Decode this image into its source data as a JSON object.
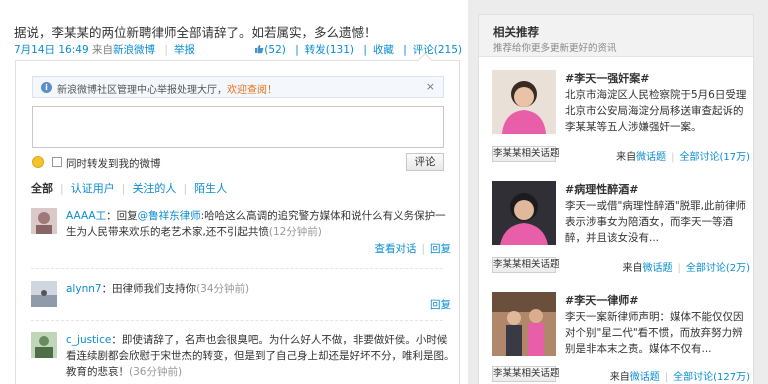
{
  "post": {
    "text": "据说，李某某的两位新聘律师全部请辞了。如若属实，多么遗憾！",
    "date": "7月14日 16:49",
    "source_prefix": "来自",
    "source": "新浪微博",
    "report": "举报",
    "likes": "(52)",
    "repost": "转发(131)",
    "favorite": "收藏",
    "comment": "评论(215)"
  },
  "composer": {
    "notice_text": "新浪微博社区管理中心举报处理大厅，",
    "notice_link": "欢迎查阅！",
    "notice_close": "×",
    "also_repost_label": "同时转发到我的微博",
    "submit_label": "评论"
  },
  "filters": {
    "all": "全部",
    "verified": "认证用户",
    "following": "关注的人",
    "strangers": "陌生人"
  },
  "comments": [
    {
      "user": "AAAA工",
      "pre": "：回复",
      "mention": "@鲁祥东律师",
      "text": ":哈哈这么高调的追究警方媒体和说什么有义务保护一生为人民带来欢乐的老艺术家,还不引起共愤",
      "time": "(12分钟前)",
      "view_thread": "查看对话",
      "reply": "回复"
    },
    {
      "user": "alynn7",
      "text": "：田律师我们支持你",
      "time": "(34分钟前)",
      "reply": "回复"
    },
    {
      "user": "c_justice",
      "text": "：即使请辞了，名声也会很臭吧。为什么好人不做，非要做奸侯。小时候看连续剧都会欣慰于宋世杰的转变，但是到了自己身上却还是好坏不分，唯利是图。教育的悲哀！",
      "time": "(36分钟前)"
    }
  ],
  "sidebar": {
    "title": "相关推荐",
    "subtitle": "推荐给你更多更新更好的资讯",
    "topics": [
      {
        "name": "#李天一强奸案#",
        "desc": "北京市海淀区人民检察院于5月6日受理北京市公安局海淀分局移送审查起诉的李某某等五人涉嫌强奸一案。",
        "tag": "李某某相关话题",
        "source_prefix": "来自",
        "source": "微话题",
        "discuss": "全部讨论(17万)"
      },
      {
        "name": "#病理性醉酒#",
        "desc": "李天一或借\"病理性醉酒\"脱罪,此前律师表示涉事女为陪酒女，而李天一等酒醉，并且该女没有...",
        "tag": "李某某相关话题",
        "source_prefix": "来自",
        "source": "微话题",
        "discuss": "全部讨论(2万)"
      },
      {
        "name": "#李天一律师#",
        "desc": "李天一案新律师声明：媒体不能仅仅因对个别\"星二代\"看不惯，而放弃努力辨别是非本末之责。媒体不仅有...",
        "tag": "李某某相关话题",
        "source_prefix": "来自",
        "source": "微话题",
        "discuss": "全部讨论(127万)"
      }
    ]
  }
}
